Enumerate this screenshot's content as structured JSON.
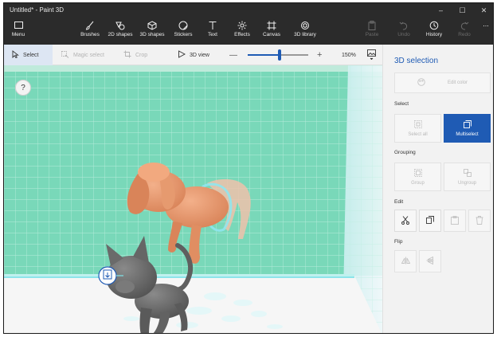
{
  "window": {
    "title": "Untitled* - Paint 3D",
    "controls": [
      "–",
      "☐",
      "✕"
    ]
  },
  "ribbon": {
    "menu": "Menu",
    "brushes": "Brushes",
    "shapes2d": "2D shapes",
    "shapes3d": "3D shapes",
    "stickers": "Stickers",
    "text": "Text",
    "effects": "Effects",
    "canvas": "Canvas",
    "library3d": "3D library",
    "paste": "Paste",
    "undo": "Undo",
    "history": "History",
    "redo": "Redo",
    "more": "..."
  },
  "toolbar": {
    "select": "Select",
    "magic_select": "Magic select",
    "crop": "Crop",
    "view3d": "3D view",
    "zoom_minus": "—",
    "zoom_plus": "+",
    "zoom_level": "150%",
    "zoom_fraction": 0.53
  },
  "canvas": {
    "help": "?"
  },
  "panel": {
    "title": "3D selection",
    "edit_color": "Edit color",
    "select_section": "Select",
    "select_all": "Select all",
    "multiselect": "Multiselect",
    "grouping_section": "Grouping",
    "group": "Group",
    "ungroup": "Ungroup",
    "edit_section": "Edit",
    "flip_section": "Flip"
  },
  "colors": {
    "accent": "#1f5bb4",
    "dark_chrome": "#2b2b2b",
    "grid_bg": "#79d8b9",
    "dog": "#e4946a",
    "cat": "#6f6f6f"
  }
}
